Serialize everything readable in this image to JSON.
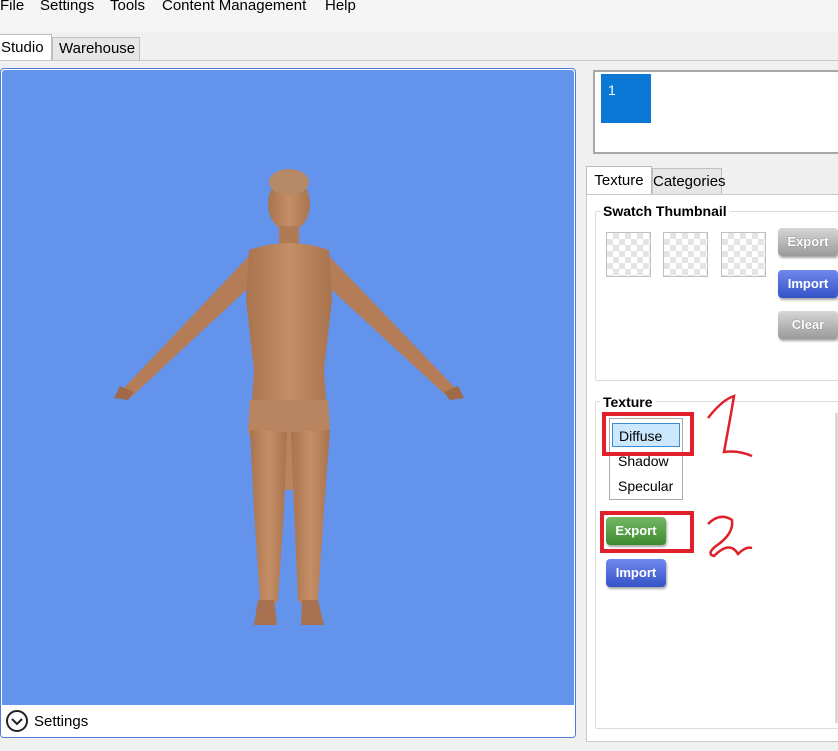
{
  "menu": [
    "File",
    "Settings",
    "Tools",
    "Content Management",
    "Help"
  ],
  "top_tabs": {
    "active": "Studio",
    "inactive": "Warehouse"
  },
  "viewport": {
    "settings_label": "Settings",
    "background_color": "#6493eb"
  },
  "thumbnail": {
    "selected_label": "1",
    "selected_color": "#0a78d4"
  },
  "right_tabs": {
    "active": "Texture",
    "inactive": "Categories"
  },
  "swatch_group": {
    "title": "Swatch Thumbnail",
    "buttons": {
      "export": "Export",
      "import": "Import",
      "clear": "Clear"
    }
  },
  "texture_group": {
    "title": "Texture",
    "items": [
      "Diffuse",
      "Shadow",
      "Specular"
    ],
    "selected": "Diffuse",
    "buttons": {
      "export": "Export",
      "import": "Import"
    }
  },
  "annotations": {
    "mark_1": "1",
    "mark_2": "2",
    "highlight_color": "#e0202a"
  }
}
